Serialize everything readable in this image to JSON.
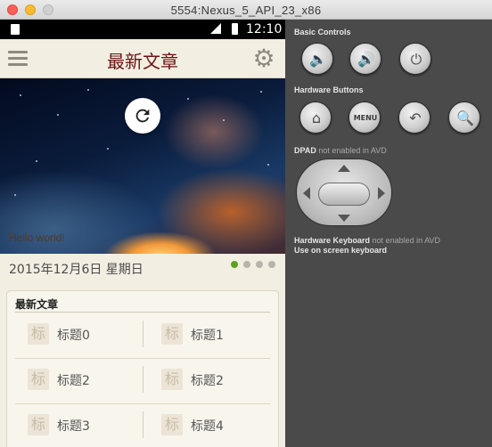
{
  "window": {
    "title": "5554:Nexus_5_API_23_x86"
  },
  "statusbar": {
    "network": "3G",
    "time": "12:10"
  },
  "appbar": {
    "title": "最新文章"
  },
  "banner": {
    "caption": "Hello world!"
  },
  "date": {
    "text": "2015年12月6日  星期日"
  },
  "pager": {
    "dots": 4,
    "active_index": 0
  },
  "card": {
    "title": "最新文章",
    "icon_char": "标",
    "items": [
      {
        "label": "标题0"
      },
      {
        "label": "标题1"
      },
      {
        "label": "标题2"
      },
      {
        "label": "标题2"
      },
      {
        "label": "标题3"
      },
      {
        "label": "标题4"
      }
    ]
  },
  "panel": {
    "basic_controls": "Basic Controls",
    "hardware_buttons": "Hardware Buttons",
    "menu_label": "MENU",
    "dpad_title": "DPAD",
    "dpad_note": "not enabled in AVD",
    "keyboard_title": "Hardware Keyboard",
    "keyboard_note": "not enabled in AVD",
    "keyboard_line2": "Use on screen keyboard"
  },
  "colors": {
    "app_title": "#6a1414",
    "active_dot": "#5ea021",
    "panel_bg": "#4a4a4a",
    "phone_bg": "#f3eee2"
  }
}
